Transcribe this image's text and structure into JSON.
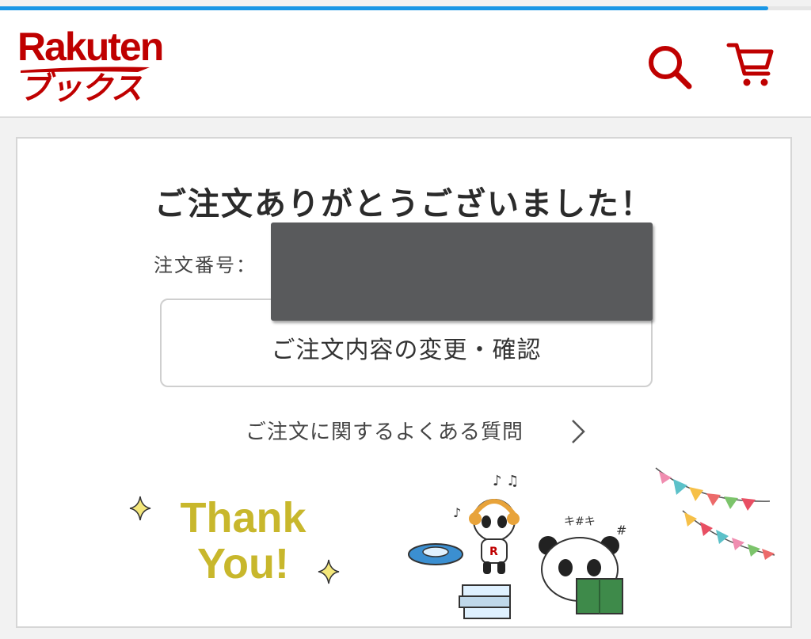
{
  "progress": {
    "fraction": 0.95,
    "color": "#1a97e6"
  },
  "header": {
    "logo_top": "Rakuten",
    "logo_bottom": "ブックス",
    "brand_color": "#bf0000",
    "icons": [
      "search-icon",
      "cart-icon"
    ]
  },
  "main": {
    "title": "ご注文ありがとうございました！",
    "order_label": "注文番号：",
    "order_value": "",
    "change_button_label": "ご注文内容の変更・確認",
    "faq_link_label": "ご注文に関するよくある質問"
  },
  "illustration": {
    "thank_line1": "Thank",
    "thank_line2": "You!",
    "thank_color": "#c8b72c"
  }
}
